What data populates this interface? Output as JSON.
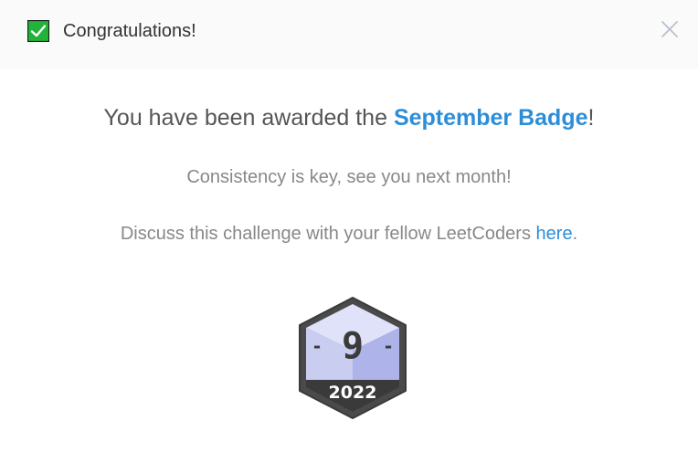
{
  "header": {
    "title": "Congratulations!",
    "icon": "checkmark-icon",
    "close_icon": "close-icon"
  },
  "body": {
    "award_prefix": "You have been awarded the ",
    "badge_name": "September Badge",
    "award_suffix": "!",
    "tagline": "Consistency is key, see you next month!",
    "discuss_prefix": "Discuss this challenge with your fellow LeetCoders ",
    "discuss_link": "here",
    "discuss_suffix": "."
  },
  "badge": {
    "month_number": "9",
    "dash_left": "-",
    "dash_right": "-",
    "year": "2022",
    "colors": {
      "outer": "#4a4a4a",
      "face_left": "#c9cdf0",
      "face_right": "#aeb3ea",
      "top": "#dfe2f8",
      "banner": "#3a3a3a",
      "text_dark": "#3b3b3b"
    }
  },
  "colors": {
    "accent": "#2d8ed8",
    "check_green": "#22b33a",
    "header_bg": "#fafafa"
  }
}
